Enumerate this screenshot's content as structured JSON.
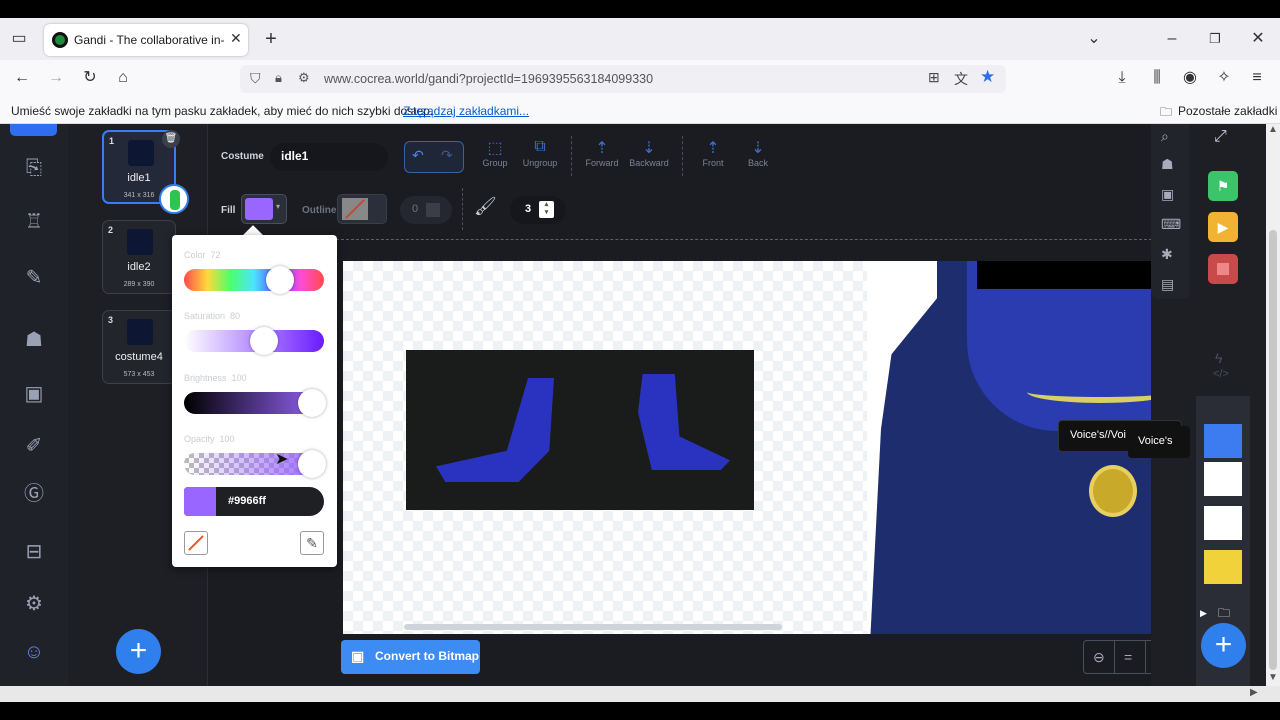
{
  "browser": {
    "tab_title": "Gandi - The collaborative in-bro",
    "url": "www.cocrea.world/gandi?projectId=1969395563184099330",
    "bookmark_prompt": "Umieść swoje zakładki na tym pasku zakładek, aby mieć do nich szybki dostęp.",
    "bookmark_manage_link": "Zarządzaj zakładkami...",
    "other_bookmarks": "Pozostałe zakładki"
  },
  "costumes": [
    {
      "num": "1",
      "name": "idle1",
      "size": "341 x 316"
    },
    {
      "num": "2",
      "name": "idle2",
      "size": "289 x 390"
    },
    {
      "num": "3",
      "name": "costume4",
      "size": "573 x 453"
    }
  ],
  "toolbar": {
    "costume_label": "Costume",
    "costume_name": "idle1",
    "group": "Group",
    "ungroup": "Ungroup",
    "forward": "Forward",
    "backward": "Backward",
    "front": "Front",
    "back": "Back",
    "fill_label": "Fill",
    "outline_label": "Outline",
    "outline_width": "0",
    "brush_size": "3"
  },
  "color_popup": {
    "color_label": "Color",
    "color_value": "72",
    "saturation_label": "Saturation",
    "saturation_value": "80",
    "brightness_label": "Brightness",
    "brightness_value": "100",
    "opacity_label": "Opacity",
    "opacity_value": "100",
    "hex": "#9966ff",
    "hex_color": "#9966ff"
  },
  "canvas": {
    "convert_button": "Convert to Bitmap"
  },
  "sprite_tooltip": "Voice's//Voi",
  "sprite_tooltip2": "Voice's",
  "colors": {
    "accent": "#2f80ed",
    "fill": "#9966ff",
    "green_flag": "#3bc46a",
    "play": "#f2b232",
    "stop": "#c84a4a"
  }
}
